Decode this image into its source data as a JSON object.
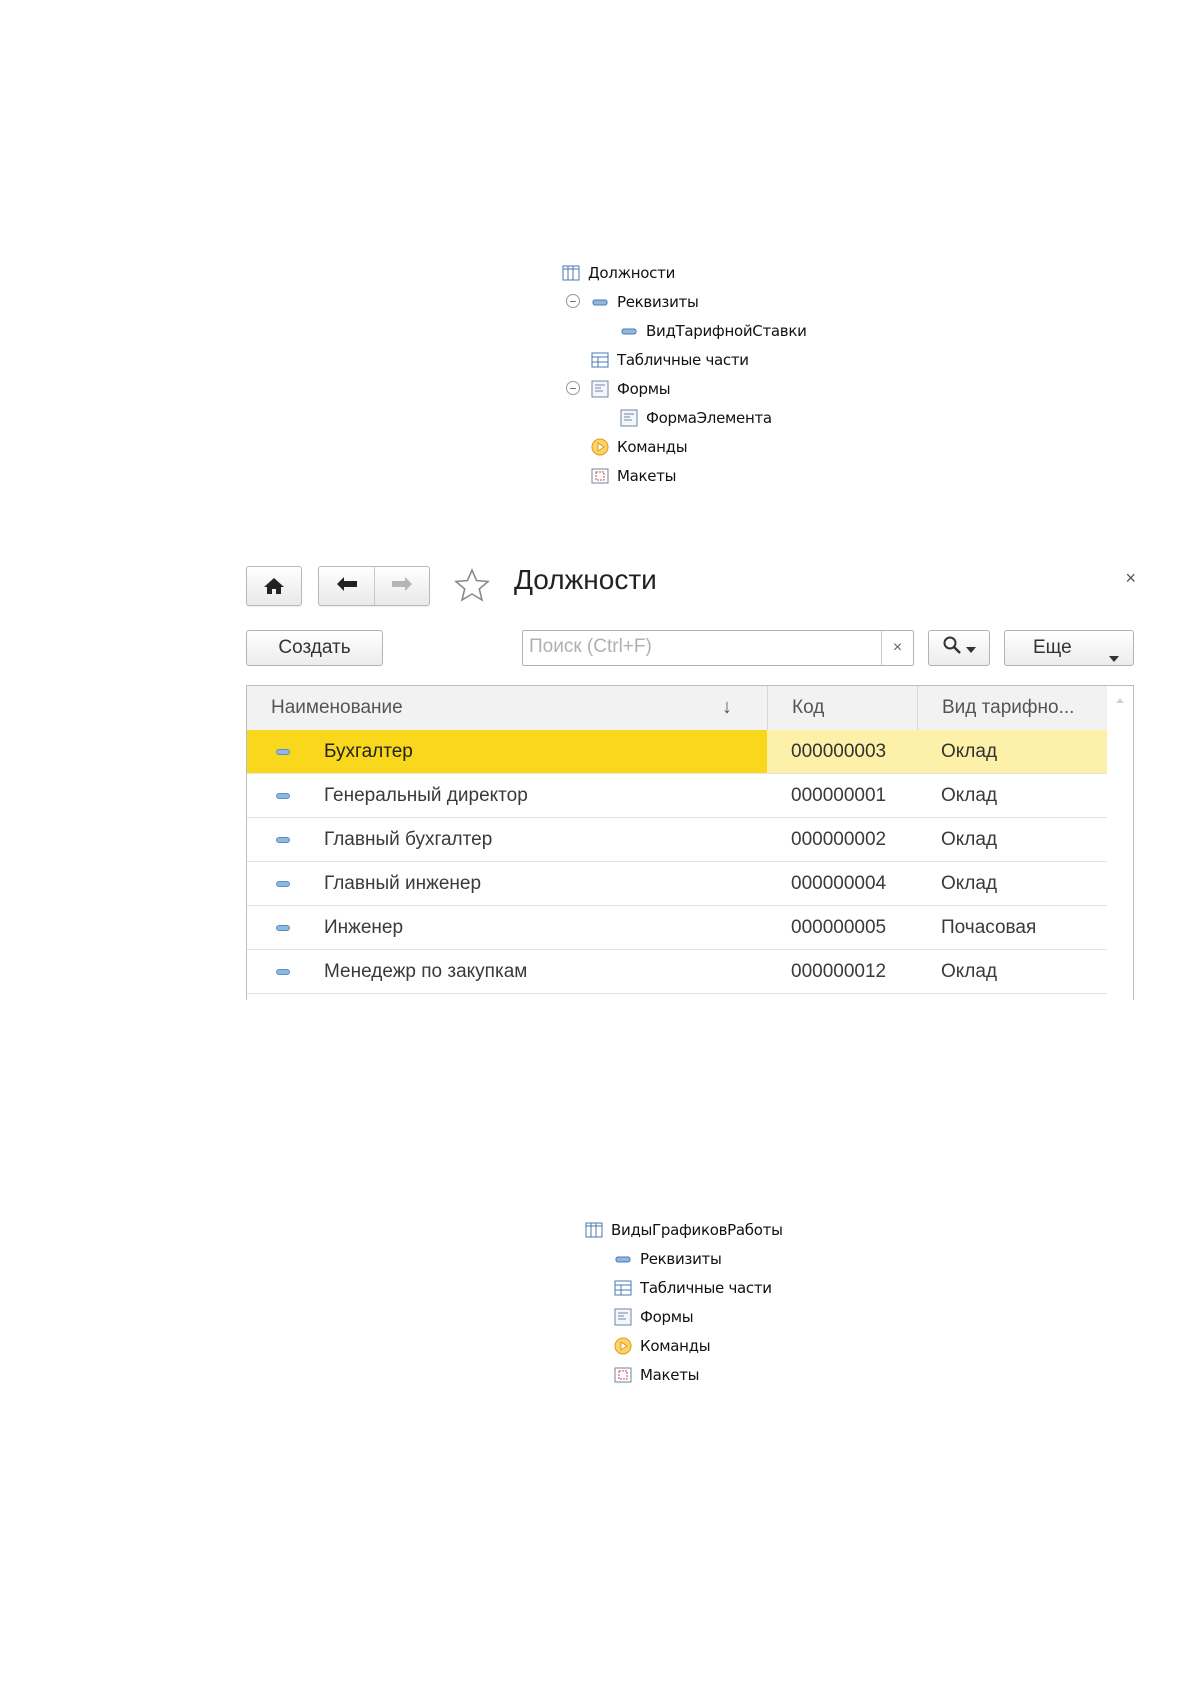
{
  "tree1": {
    "root": "Должности",
    "items": [
      {
        "label": "Реквизиты",
        "icon": "attribute-icon"
      },
      {
        "label": "ВидТарифнойСтавки",
        "icon": "attribute-icon"
      },
      {
        "label": "Табличные части",
        "icon": "table-icon"
      },
      {
        "label": "Формы",
        "icon": "form-icon"
      },
      {
        "label": "ФормаЭлемента",
        "icon": "form-icon"
      },
      {
        "label": "Команды",
        "icon": "command-icon"
      },
      {
        "label": "Макеты",
        "icon": "template-icon"
      }
    ]
  },
  "form": {
    "title": "Должности",
    "close": "×",
    "create_label": "Создать",
    "search_placeholder": "Поиск (Ctrl+F)",
    "search_clear": "×",
    "more_label": "Еще",
    "columns": [
      "Наименование",
      "Код",
      "Вид тарифно..."
    ],
    "sort_indicator": "↓",
    "rows": [
      {
        "name": "Бухгалтер",
        "code": "000000003",
        "rate": "Оклад",
        "selected": true
      },
      {
        "name": "Генеральный директор",
        "code": "000000001",
        "rate": "Оклад"
      },
      {
        "name": "Главный бухгалтер",
        "code": "000000002",
        "rate": "Оклад"
      },
      {
        "name": "Главный инженер",
        "code": "000000004",
        "rate": "Оклад"
      },
      {
        "name": "Инженер",
        "code": "000000005",
        "rate": "Почасовая"
      },
      {
        "name": "Менедежр по закупкам",
        "code": "000000012",
        "rate": "Оклад"
      }
    ],
    "colors": {
      "selected_name": "#f9d71c",
      "selected_row": "#fdf0a8"
    }
  },
  "tree2": {
    "root": "ВидыГрафиковРаботы",
    "items": [
      {
        "label": "Реквизиты",
        "icon": "attribute-icon"
      },
      {
        "label": "Табличные части",
        "icon": "table-icon"
      },
      {
        "label": "Формы",
        "icon": "form-icon"
      },
      {
        "label": "Команды",
        "icon": "command-icon"
      },
      {
        "label": "Макеты",
        "icon": "template-icon"
      }
    ]
  }
}
